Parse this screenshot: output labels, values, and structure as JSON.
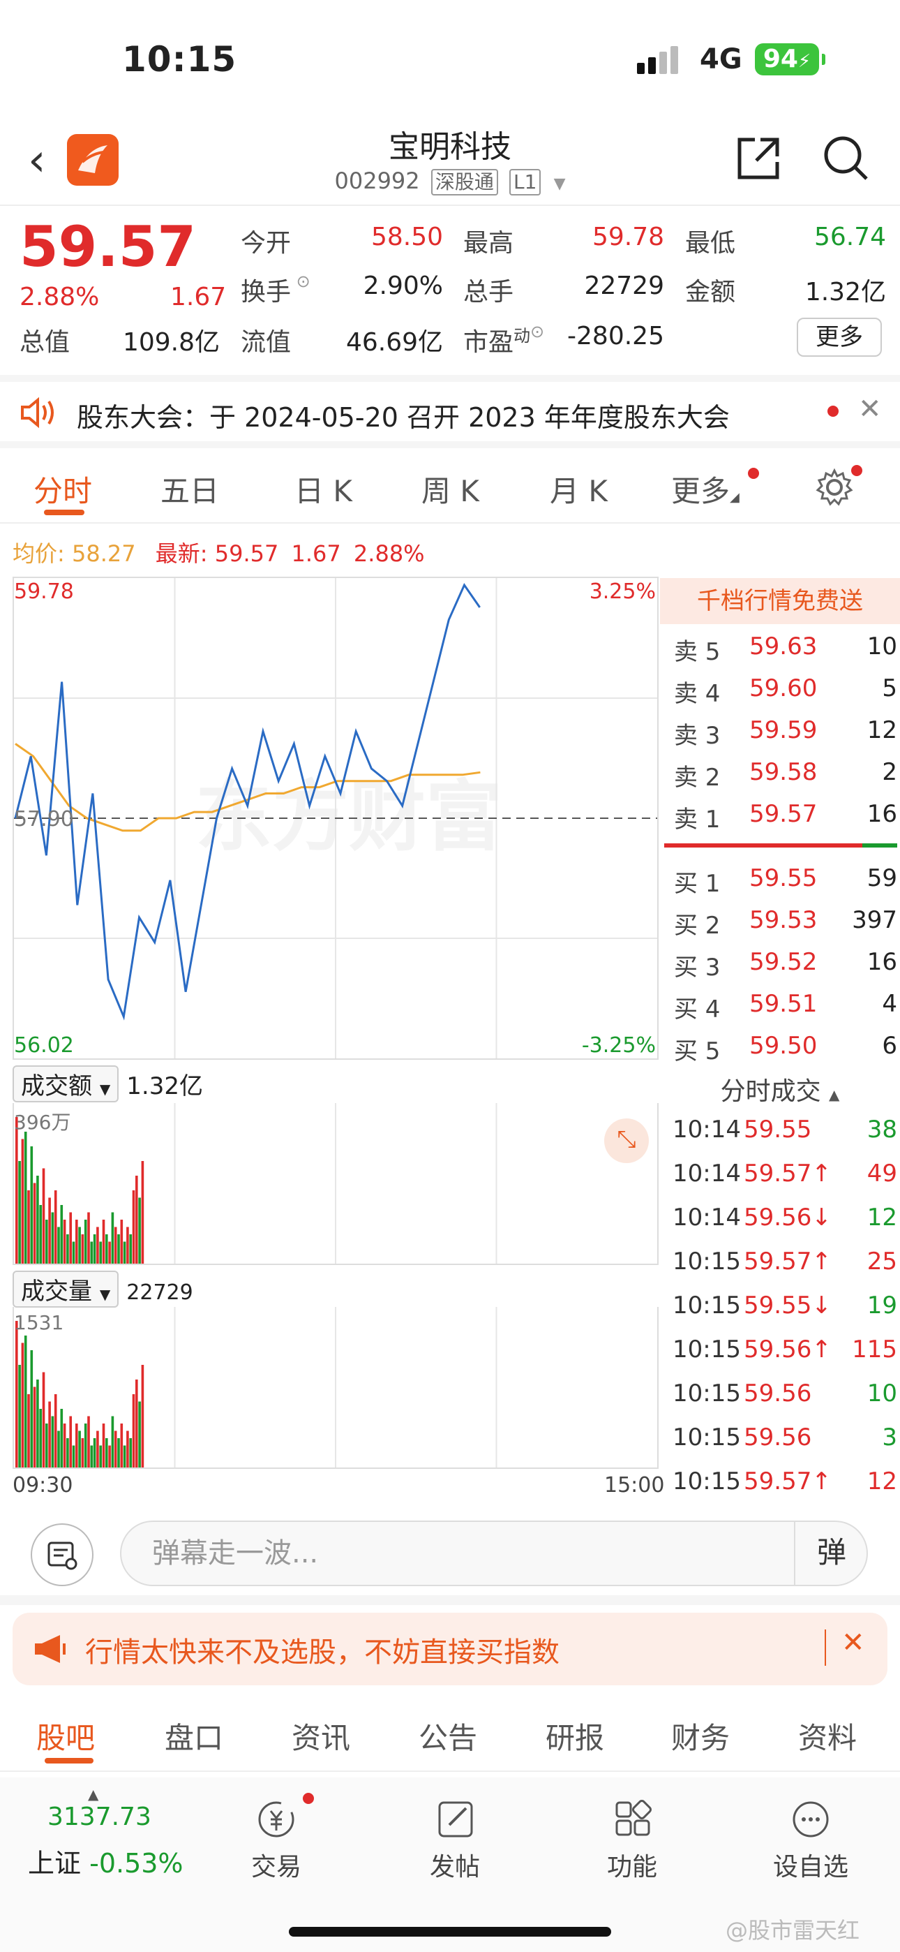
{
  "status": {
    "time": "10:15",
    "network": "4G",
    "battery": "94"
  },
  "header": {
    "title": "宝明科技",
    "code": "002992",
    "tag1": "深股通",
    "tag2": "L1"
  },
  "quote": {
    "price": "59.57",
    "pct": "2.88%",
    "change": "1.67",
    "open_label": "今开",
    "open": "58.50",
    "high_label": "最高",
    "high": "59.78",
    "low_label": "最低",
    "low": "56.74",
    "turnover_label": "换手",
    "turnover": "2.90%",
    "volume_label": "总手",
    "volume": "22729",
    "amount_label": "金额",
    "amount": "1.32亿",
    "mktcap_label": "总值",
    "mktcap": "109.8亿",
    "float_label": "流值",
    "float": "46.69亿",
    "pe_label": "市盈",
    "pe_sup": "动",
    "pe": "-280.25",
    "more": "更多"
  },
  "notice": {
    "text": "股东大会：于 2024-05-20 召开 2023 年年度股东大会"
  },
  "tabs": [
    "分时",
    "五日",
    "日 K",
    "周 K",
    "月 K",
    "更多"
  ],
  "avg": {
    "avg_label": "均价:",
    "avg": "58.27",
    "latest_label": "最新:",
    "latest": "59.57",
    "chg": "1.67",
    "pct": "2.88%"
  },
  "chart_data": {
    "type": "line",
    "title": "",
    "y_top": "59.78",
    "y_mid": "57.90",
    "y_bottom": "56.02",
    "pct_top": "3.25%",
    "pct_bottom": "-3.25%",
    "x_start": "09:30",
    "x_end": "15:00",
    "ylim": [
      56.02,
      59.78
    ],
    "price": [
      57.9,
      58.4,
      57.6,
      59.0,
      57.2,
      58.1,
      56.6,
      56.3,
      57.1,
      56.9,
      57.4,
      56.5,
      57.2,
      57.9,
      58.3,
      58.0,
      58.6,
      58.2,
      58.5,
      58.0,
      58.4,
      58.1,
      58.6,
      58.3,
      58.2,
      58.0,
      58.5,
      59.0,
      59.5,
      59.78,
      59.6
    ],
    "avg": [
      58.5,
      58.4,
      58.2,
      58.0,
      57.9,
      57.85,
      57.8,
      57.8,
      57.9,
      57.9,
      57.95,
      57.95,
      58.0,
      58.05,
      58.1,
      58.1,
      58.15,
      58.15,
      58.2,
      58.2,
      58.2,
      58.2,
      58.25,
      58.25,
      58.25,
      58.25,
      58.27
    ],
    "amount_label": "成交额",
    "amount_total": "1.32亿",
    "amount_max": "396万",
    "volume_label": "成交量",
    "volume_total": "22729",
    "volume_max": "1531",
    "bars": [
      1.0,
      0.7,
      0.85,
      0.9,
      0.5,
      0.8,
      0.55,
      0.6,
      0.4,
      0.65,
      0.3,
      0.45,
      0.35,
      0.5,
      0.25,
      0.4,
      0.3,
      0.2,
      0.35,
      0.15,
      0.3,
      0.25,
      0.2,
      0.3,
      0.35,
      0.15,
      0.2,
      0.25,
      0.15,
      0.3,
      0.2,
      0.15,
      0.35,
      0.25,
      0.2,
      0.3,
      0.15,
      0.25,
      0.2,
      0.5,
      0.6,
      0.45,
      0.7
    ],
    "bar_colors": [
      "r",
      "g",
      "r",
      "g",
      "r",
      "g",
      "r",
      "g",
      "g",
      "r",
      "g",
      "r",
      "g",
      "r",
      "g",
      "g",
      "r",
      "g",
      "r",
      "g",
      "r",
      "g",
      "r",
      "g",
      "r",
      "g",
      "g",
      "r",
      "g",
      "r",
      "g",
      "r",
      "g",
      "r",
      "g",
      "r",
      "g",
      "r",
      "g",
      "r",
      "r",
      "g",
      "r"
    ]
  },
  "orderbook": {
    "header": "千档行情免费送",
    "sell": [
      {
        "label": "卖 5",
        "price": "59.63",
        "qty": "10"
      },
      {
        "label": "卖 4",
        "price": "59.60",
        "qty": "5"
      },
      {
        "label": "卖 3",
        "price": "59.59",
        "qty": "12"
      },
      {
        "label": "卖 2",
        "price": "59.58",
        "qty": "2"
      },
      {
        "label": "卖 1",
        "price": "59.57",
        "qty": "16"
      }
    ],
    "buy": [
      {
        "label": "买 1",
        "price": "59.55",
        "qty": "59"
      },
      {
        "label": "买 2",
        "price": "59.53",
        "qty": "397"
      },
      {
        "label": "买 3",
        "price": "59.52",
        "qty": "16"
      },
      {
        "label": "买 4",
        "price": "59.51",
        "qty": "4"
      },
      {
        "label": "买 5",
        "price": "59.50",
        "qty": "6"
      }
    ],
    "trades_title": "分时成交",
    "trades": [
      {
        "time": "10:14",
        "price": "59.55",
        "qty": "38",
        "dir": "",
        "qc": "green"
      },
      {
        "time": "10:14",
        "price": "59.57↑",
        "qty": "49",
        "dir": "up",
        "qc": "red"
      },
      {
        "time": "10:14",
        "price": "59.56↓",
        "qty": "12",
        "dir": "down",
        "qc": "green"
      },
      {
        "time": "10:15",
        "price": "59.57↑",
        "qty": "25",
        "dir": "up",
        "qc": "red"
      },
      {
        "time": "10:15",
        "price": "59.55↓",
        "qty": "19",
        "dir": "down",
        "qc": "green"
      },
      {
        "time": "10:15",
        "price": "59.56↑",
        "qty": "115",
        "dir": "up",
        "qc": "red"
      },
      {
        "time": "10:15",
        "price": "59.56",
        "qty": "10",
        "dir": "",
        "qc": "green"
      },
      {
        "time": "10:15",
        "price": "59.56",
        "qty": "3",
        "dir": "",
        "qc": "green"
      },
      {
        "time": "10:15",
        "price": "59.57↑",
        "qty": "12",
        "dir": "up",
        "qc": "red"
      }
    ]
  },
  "comment": {
    "placeholder": "弹幕走一波...",
    "danmu": "弹"
  },
  "promo": {
    "text": "行情太快来不及选股，不妨直接买指数"
  },
  "bottom_tabs": [
    "股吧",
    "盘口",
    "资讯",
    "公告",
    "研报",
    "财务",
    "资料"
  ],
  "dock": {
    "index_value": "3137.73",
    "index_name": "上证",
    "index_pct": "-0.53%",
    "trade": "交易",
    "post": "发帖",
    "func": "功能",
    "watch": "设自选"
  },
  "watermark": "@股市雷天红",
  "colors": {
    "up": "#e02b2b",
    "down": "#1a9a2e",
    "accent": "#e8581e",
    "avg": "#f0a830",
    "price": "#2a6bc4"
  }
}
